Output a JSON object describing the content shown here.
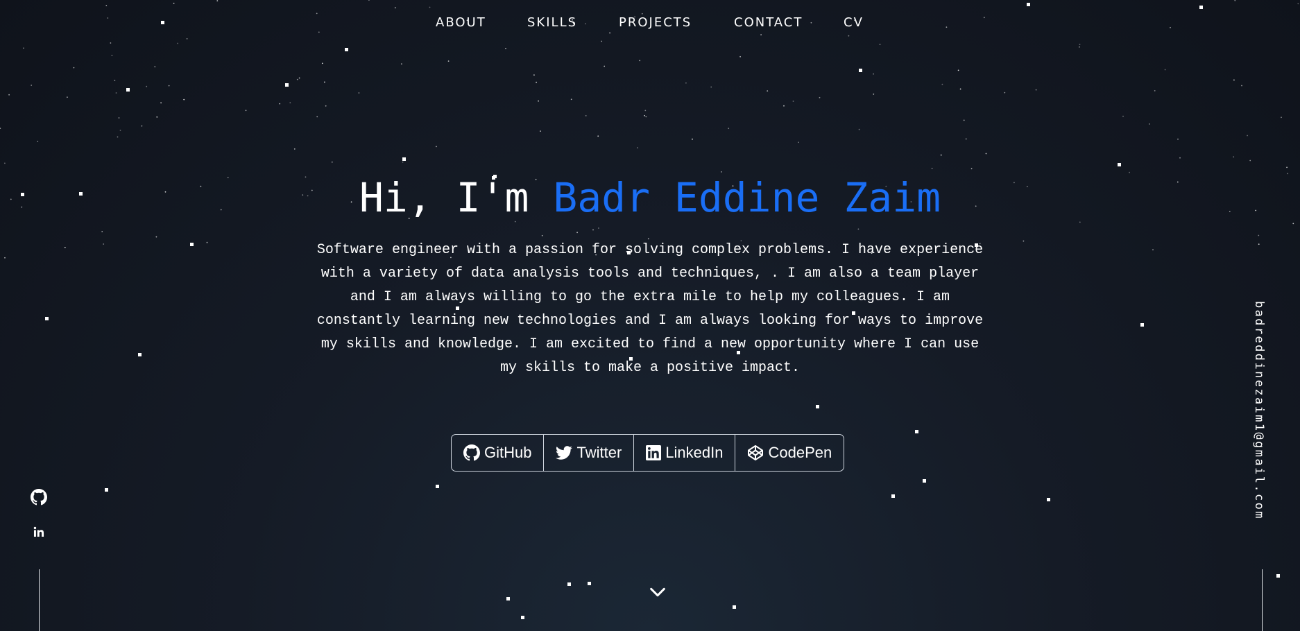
{
  "nav": {
    "items": [
      "ABOUT",
      "SKILLS",
      "PROJECTS",
      "CONTACT",
      "CV"
    ]
  },
  "hero": {
    "greeting": "Hi, I'm",
    "name": "Badr Eddine Zaim",
    "bio": "Software engineer with a passion for solving complex problems. I have experience with a variety of data analysis tools and techniques, . I am also a team player and I am always willing to go the extra mile to help my colleagues. I am constantly learning new technologies and I am always looking for ways to improve my skills and knowledge. I am excited to find a new opportunity where I can use my skills to make a positive impact."
  },
  "social_buttons": [
    {
      "label": "GitHub",
      "icon": "github-icon"
    },
    {
      "label": "Twitter",
      "icon": "twitter-icon"
    },
    {
      "label": "LinkedIn",
      "icon": "linkedin-icon"
    },
    {
      "label": "CodePen",
      "icon": "codepen-icon"
    }
  ],
  "side_left_icons": [
    "github-icon",
    "linkedin-icon"
  ],
  "side_right": {
    "email": "badreddinezaim1@gmail.com"
  },
  "scroll_icon": "chevron-down-icon",
  "colors": {
    "accent": "#1a6ef5",
    "background_center": "#1b2735",
    "background_edge": "#0f131b",
    "text": "#ffffff"
  }
}
